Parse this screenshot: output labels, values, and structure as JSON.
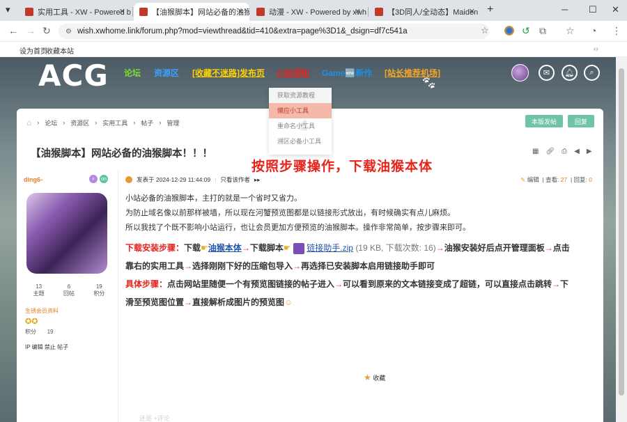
{
  "browser": {
    "tabs": [
      {
        "title": "实用工具 - XW - Powered by"
      },
      {
        "title": "【油猴脚本】网站必备的油猴脚"
      },
      {
        "title": "动漫 - XW - Powered by xwh"
      },
      {
        "title": "【3D同人/全动态】Maiden M"
      }
    ],
    "new_tab": "+",
    "url": "wish.xwhome.link/forum.php?mod=viewthread&tid=410&extra=page%3D1&_dsign=df7c541a",
    "bookmarks": [
      "设为首页",
      "收藏本站"
    ]
  },
  "header": {
    "logo": "ACG",
    "nav": [
      {
        "label": "论坛",
        "color": "#7be030"
      },
      {
        "label": "资源区",
        "color": "#3aa0ff"
      },
      {
        "label": "[收藏不迷路]发布页",
        "color": "#ffd200"
      },
      {
        "label": "小站须知",
        "color": "#e8231c"
      },
      {
        "label": "Game🆕新作",
        "color": "#1b8fe6"
      },
      {
        "label": "[站长推荐机场]",
        "color": "#f5a623"
      }
    ],
    "dropdown": [
      "获取资源教程",
      "懒应小工具",
      "重命名小工具",
      "溯区必备小工具"
    ]
  },
  "breadcrumb": [
    "论坛",
    "资源区",
    "实用工具",
    "帖子",
    "管理"
  ],
  "actions": {
    "new_post": "本版发帖",
    "reply": "回复"
  },
  "thread": {
    "title": "【油猴脚本】网站必备的油猴脚本！！！",
    "overlay_caption": "按照步骤操作，下载油猴本体"
  },
  "author": {
    "name": "ding6-",
    "stats": [
      {
        "value": "13",
        "label": "主题"
      },
      {
        "value": "6",
        "label": "回帖"
      },
      {
        "value": "19",
        "label": "积分"
      }
    ],
    "group_link": "生锈会员资料",
    "points_label": "积分",
    "points_value": "19",
    "actions": "IP 编辑 禁止 帖子"
  },
  "post": {
    "posted_at": "发表于 2024-12-29 11:44:09",
    "only_author": "只看该作者",
    "edit": "编辑",
    "views_label": "查看:",
    "views": "27",
    "replies_label": "回复:",
    "replies": "0",
    "para1": "小站必备的油猴脚本，主打的就是一个省时又省力。",
    "para2": "为防止域名像以前那样被墙，所以现在河蟹预览图都是以链接形式放出，有时候确实有点儿麻烦。",
    "para3": "所以我找了个既不影响小站运行，也让会员更加方便预览的油猴脚本。操作非常简单，按步骤来即可。",
    "step1_label": "下载安装步骤：",
    "step1_a": "下载",
    "step1_link1": "油猴本体",
    "step1_b": "下载脚本",
    "attachment": "链接助手.zip",
    "attachment_info": "(19 KB, 下载次数: 16)",
    "step1_c": "油猴安装好后点开管理面板",
    "step1_d": "点击",
    "step1_e": "靠右的实用工具",
    "step1_f": "选择刚刚下好的压缩包导入",
    "step1_g": "再选择已安装脚本启用链接助手即可",
    "step2_label": "具体步骤：",
    "step2_a": "点击网站里随便一个有预览图链接的帖子进入",
    "step2_b": "可以看到原来的文本链接变成了超链，可以直接点击跳转",
    "step2_c": "下",
    "step2_d": "滑至预览图位置",
    "step2_e": "直接解析成图片的预览图",
    "collect": "收藏"
  },
  "footer_hint": "还是    +评论"
}
